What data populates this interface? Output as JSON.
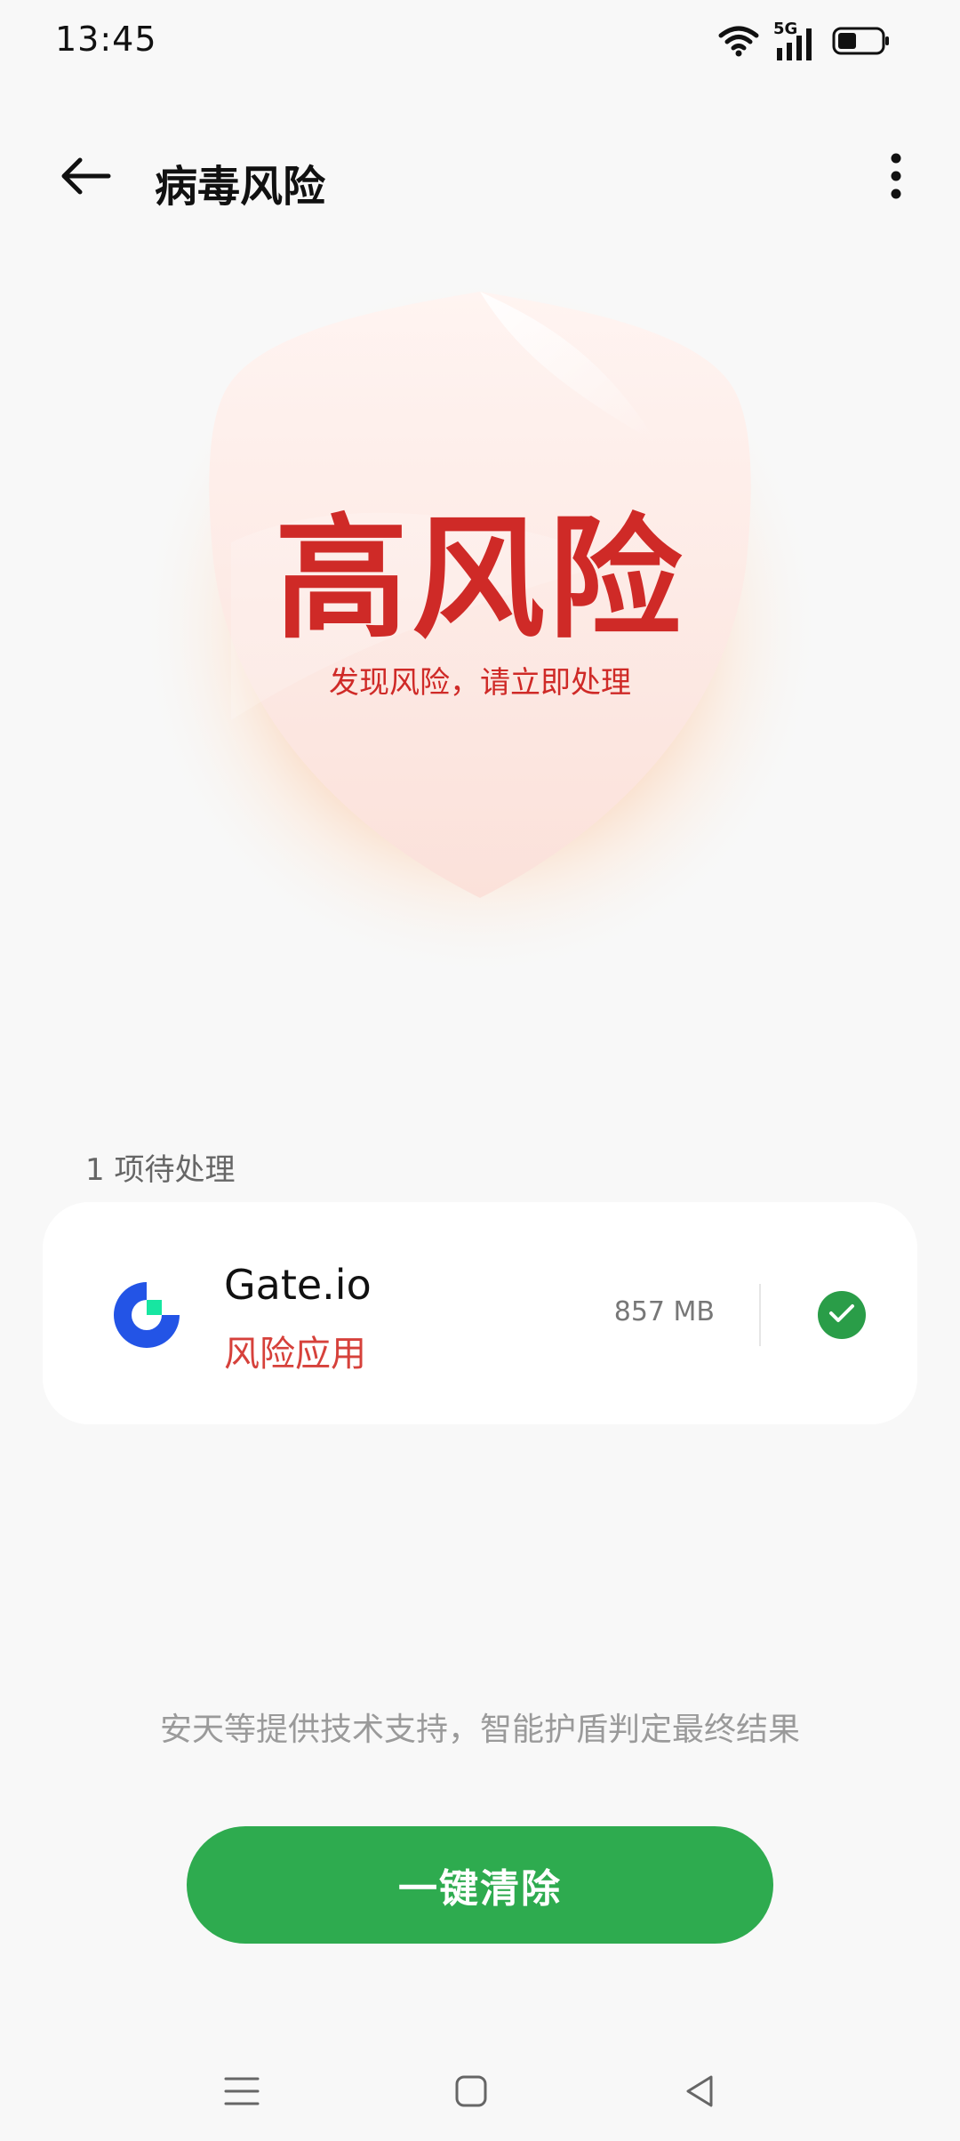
{
  "status_bar": {
    "time": "13:45",
    "network": "5G",
    "icons": [
      "wifi-icon",
      "cellular-signal-icon",
      "battery-icon"
    ]
  },
  "header": {
    "title": "病毒风险",
    "back_icon": "back-arrow-icon",
    "more_icon": "more-vertical-icon"
  },
  "shield": {
    "risk_level": "高风险",
    "message": "发现风险，请立即处理"
  },
  "pending": {
    "label": "1 项待处理"
  },
  "apps": [
    {
      "name": "Gate.io",
      "risk": "风险应用",
      "size": "857 MB",
      "selected": true
    }
  ],
  "footer": {
    "support_note": "安天等提供技术支持，智能护盾判定最终结果",
    "clean_button": "一键清除"
  },
  "colors": {
    "accent_green": "#2eab4f",
    "risk_red": "#cf2a27",
    "glow_orange": "#ff8a3d"
  },
  "navigation": [
    "menu-icon",
    "home-icon",
    "back-triangle-icon"
  ]
}
